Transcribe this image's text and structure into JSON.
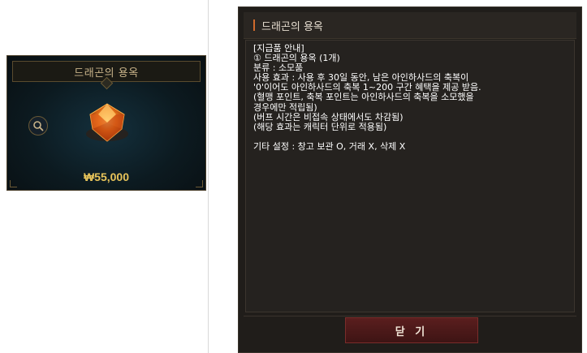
{
  "product_card": {
    "title": "드래곤의 용옥",
    "price": "₩55,000",
    "zoom_icon": "magnifier-icon",
    "item_icon": "orange-gem-icon"
  },
  "dialog": {
    "title": "드래곤의 용옥",
    "lines_top": [
      "[지급품 안내]",
      "① 드래곤의 용옥 (1개)",
      "분류 : 소모품",
      "사용 효과 : 사용 후 30일 동안, 남은 아인하사드의 축복이",
      "'0'이어도 아인하사드의 축복 1~200 구간 혜택을 제공 받음.",
      "(혈맹 포인트, 축복 포인트는 아인하사드의 축복을 소모했을",
      "경우에만 적립됨)",
      "(버프 시간은 비접속 상태에서도 차감됨)",
      "(해당 효과는 캐릭터 단위로 적용됨)"
    ],
    "lines_bottom": [
      "기타 설정 : 창고 보관 O, 거래 X, 삭제 X"
    ],
    "close_label": "닫 기"
  },
  "colors": {
    "accent": "#d06a2c",
    "price": "#e8c45a",
    "close_button": "#5a1e1e"
  }
}
